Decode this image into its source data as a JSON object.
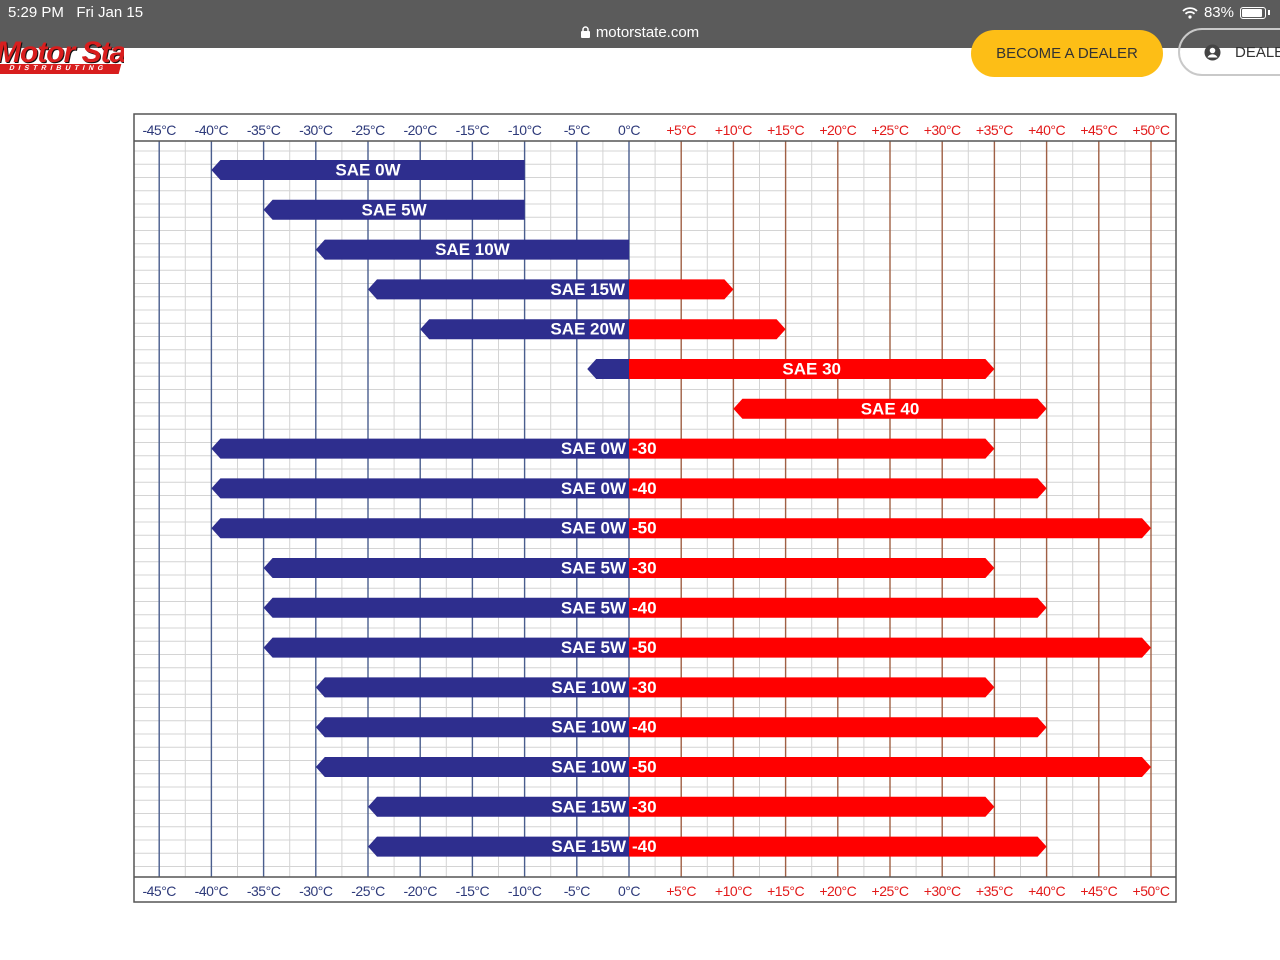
{
  "status_bar": {
    "time": "5:29 PM",
    "date": "Fri Jan 15",
    "url": "motorstate.com",
    "battery": "83%",
    "battery_level": 0.83
  },
  "header": {
    "logo_text": "Motor State",
    "logo_subtext": "DISTRIBUTING",
    "become_dealer": "BECOME A DEALER",
    "dealer_login": "DEALER"
  },
  "colors": {
    "cold": "#2e2e8e",
    "hot": "#ff0000",
    "cold_grid": "#4a5e8e",
    "hot_grid": "#a06045",
    "minor_grid": "#d4d4d4",
    "cold_tick_text": "#2e3a7a",
    "hot_tick_text": "#e21a1a"
  },
  "chart_data": {
    "type": "bar",
    "orientation": "horizontal-range",
    "x_unit": "°C",
    "xlim": [
      -45,
      50
    ],
    "x_ticks": [
      -45,
      -40,
      -35,
      -30,
      -25,
      -20,
      -15,
      -10,
      -5,
      0,
      5,
      10,
      15,
      20,
      25,
      30,
      35,
      40,
      45,
      50
    ],
    "x_tick_labels": [
      "-45°C",
      "-40°C",
      "-35°C",
      "-30°C",
      "-25°C",
      "-20°C",
      "-15°C",
      "-10°C",
      "-5°C",
      "0°C",
      "+5°C",
      "+10°C",
      "+15°C",
      "+20°C",
      "+25°C",
      "+30°C",
      "+35°C",
      "+40°C",
      "+45°C",
      "+50°C"
    ],
    "grid": true,
    "series": [
      {
        "left": "SAE 0W",
        "right": "",
        "min": -40,
        "max": -10,
        "boundary": -10,
        "label_side": "cold"
      },
      {
        "left": "SAE 5W",
        "right": "",
        "min": -35,
        "max": -10,
        "boundary": -10,
        "label_side": "cold"
      },
      {
        "left": "SAE 10W",
        "right": "",
        "min": -30,
        "max": 0,
        "boundary": 0,
        "label_side": "cold"
      },
      {
        "left": "SAE 15W",
        "right": "",
        "min": -25,
        "max": 10,
        "boundary": 0,
        "label_side": "cold"
      },
      {
        "left": "SAE 20W",
        "right": "",
        "min": -20,
        "max": 15,
        "boundary": 0,
        "label_side": "cold"
      },
      {
        "left": "",
        "right": "SAE 30",
        "min": -4,
        "max": 35,
        "boundary": 0,
        "label_side": "hot"
      },
      {
        "left": "",
        "right": "SAE 40",
        "min": 10,
        "max": 40,
        "boundary": 10,
        "label_side": "hot"
      },
      {
        "left": "SAE 0W",
        "right": "-30",
        "min": -40,
        "max": 35,
        "boundary": 0,
        "label_side": "both"
      },
      {
        "left": "SAE 0W",
        "right": "-40",
        "min": -40,
        "max": 40,
        "boundary": 0,
        "label_side": "both"
      },
      {
        "left": "SAE 0W",
        "right": "-50",
        "min": -40,
        "max": 50,
        "boundary": 0,
        "label_side": "both"
      },
      {
        "left": "SAE 5W",
        "right": "-30",
        "min": -35,
        "max": 35,
        "boundary": 0,
        "label_side": "both"
      },
      {
        "left": "SAE 5W",
        "right": "-40",
        "min": -35,
        "max": 40,
        "boundary": 0,
        "label_side": "both"
      },
      {
        "left": "SAE 5W",
        "right": "-50",
        "min": -35,
        "max": 50,
        "boundary": 0,
        "label_side": "both"
      },
      {
        "left": "SAE 10W",
        "right": "-30",
        "min": -30,
        "max": 35,
        "boundary": 0,
        "label_side": "both"
      },
      {
        "left": "SAE 10W",
        "right": "-40",
        "min": -30,
        "max": 40,
        "boundary": 0,
        "label_side": "both"
      },
      {
        "left": "SAE 10W",
        "right": "-50",
        "min": -30,
        "max": 50,
        "boundary": 0,
        "label_side": "both"
      },
      {
        "left": "SAE 15W",
        "right": "-30",
        "min": -25,
        "max": 35,
        "boundary": 0,
        "label_side": "both"
      },
      {
        "left": "SAE 15W",
        "right": "-40",
        "min": -25,
        "max": 40,
        "boundary": 0,
        "label_side": "both"
      }
    ]
  }
}
